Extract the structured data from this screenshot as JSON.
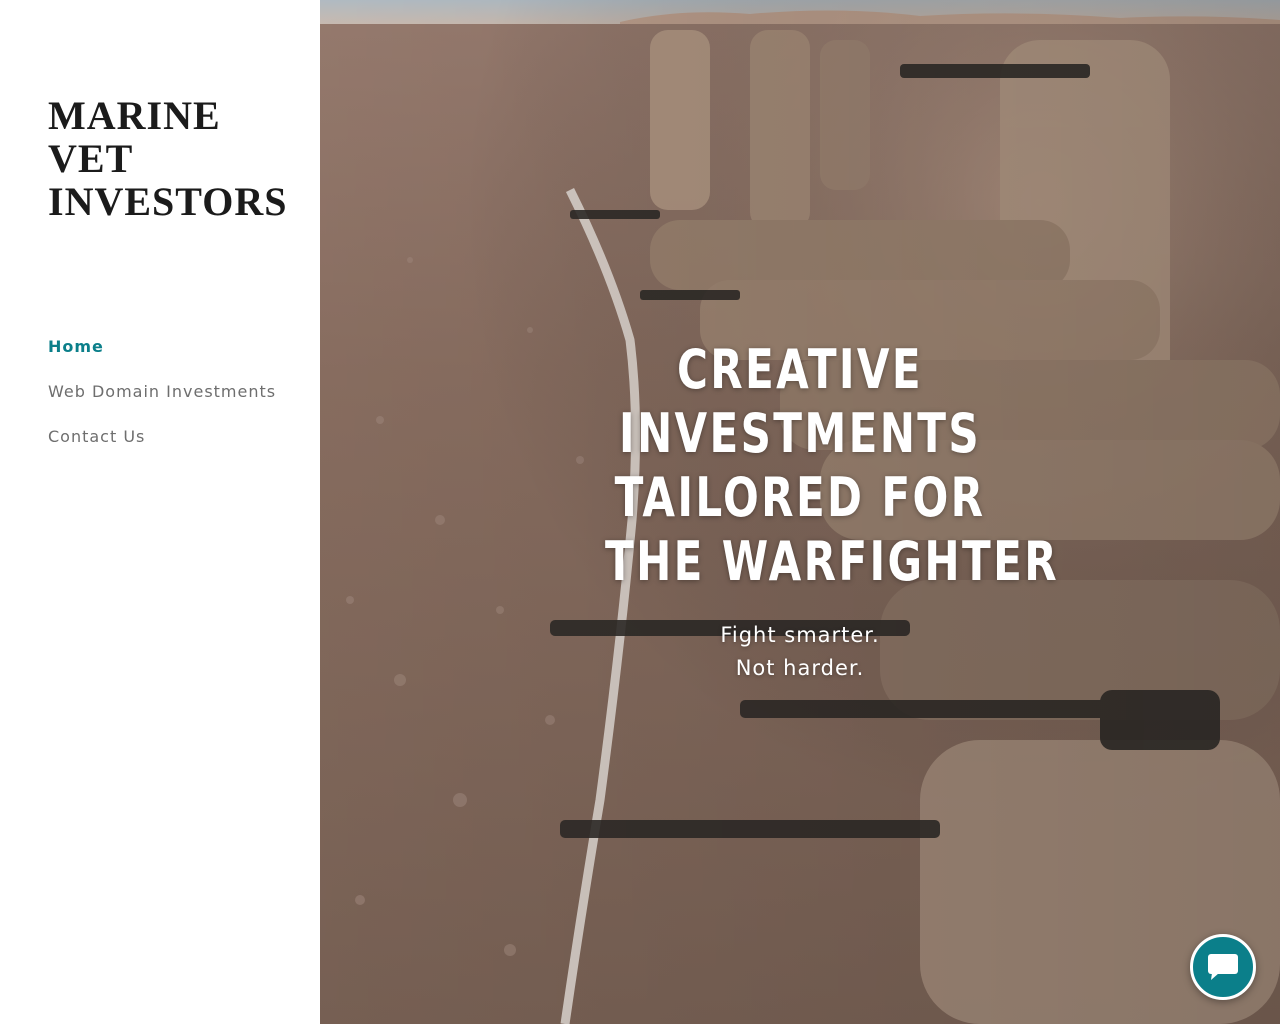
{
  "site": {
    "logo_lines": [
      "MARINE",
      "VET",
      "INVESTORS"
    ]
  },
  "nav": {
    "items": [
      {
        "label": "Home",
        "active": true
      },
      {
        "label": "Web Domain Investments",
        "active": false
      },
      {
        "label": "Contact Us",
        "active": false
      }
    ]
  },
  "hero": {
    "headline_lines": [
      "CREATIVE",
      "INVESTMENTS",
      "TAILORED FOR",
      "THE WARFIGHTER"
    ],
    "tagline_lines": [
      "Fight smarter.",
      "Not harder."
    ],
    "background_image": "marines-prone-firing-range-desert"
  },
  "chat": {
    "icon": "chat-bubble-icon"
  },
  "colors": {
    "accent": "#0b7f8a",
    "nav_text": "#6e6e6e",
    "logo_text": "#1b1b1b"
  }
}
